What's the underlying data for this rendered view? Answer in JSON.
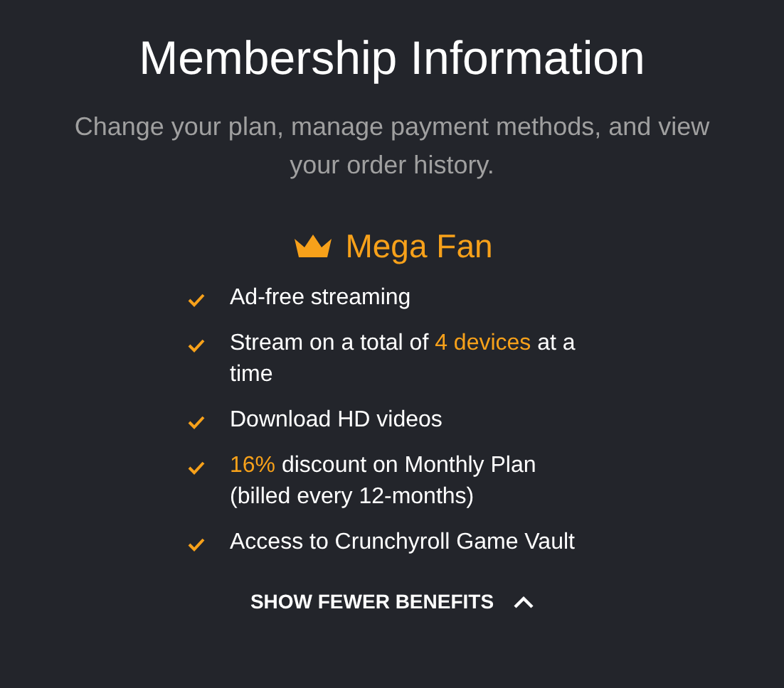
{
  "header": {
    "title": "Membership Information",
    "subtitle": "Change your plan, manage payment methods, and view your order history."
  },
  "plan": {
    "name": "Mega Fan"
  },
  "benefits": [
    {
      "parts": [
        {
          "text": "Ad-free streaming",
          "highlight": false
        }
      ]
    },
    {
      "parts": [
        {
          "text": "Stream on a total of ",
          "highlight": false
        },
        {
          "text": "4 devices",
          "highlight": true
        },
        {
          "text": " at a time",
          "highlight": false
        }
      ]
    },
    {
      "parts": [
        {
          "text": "Download HD videos",
          "highlight": false
        }
      ]
    },
    {
      "parts": [
        {
          "text": "16%",
          "highlight": true
        },
        {
          "text": " discount on Monthly Plan (billed every 12-months)",
          "highlight": false
        }
      ]
    },
    {
      "parts": [
        {
          "text": "Access to Crunchyroll Game Vault",
          "highlight": false
        }
      ]
    }
  ],
  "toggle": {
    "label": "SHOW FEWER BENEFITS",
    "expanded": true
  }
}
